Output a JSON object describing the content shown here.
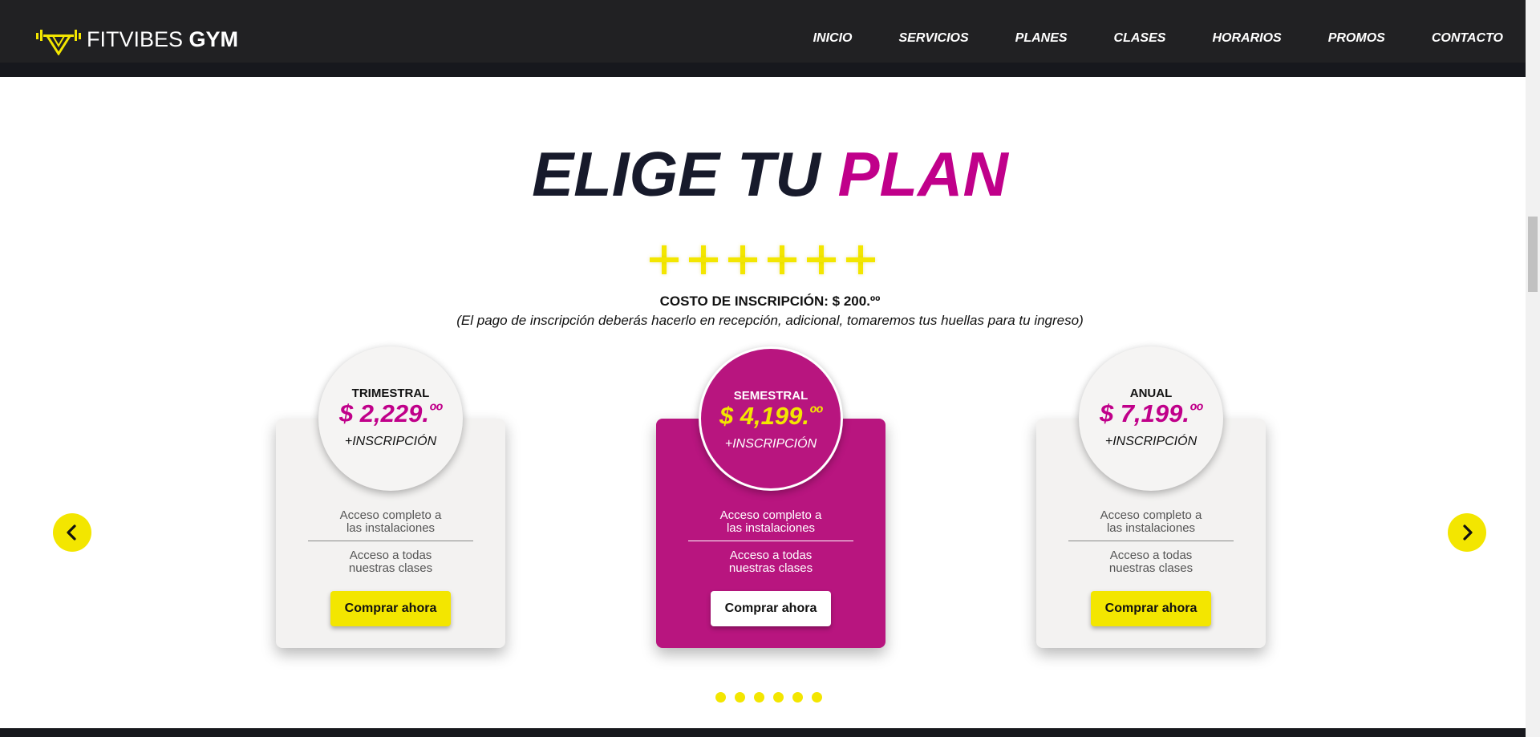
{
  "brand": {
    "name_light": "FITVIBES",
    "name_bold": "GYM",
    "logo_icon": "dumbbell-v-icon"
  },
  "nav": {
    "items": [
      "INICIO",
      "SERVICIOS",
      "PLANES",
      "CLASES",
      "HORARIOS",
      "PROMOS",
      "CONTACTO"
    ]
  },
  "section": {
    "title_part1": "ELIGE TU",
    "title_part2": "PLAN",
    "decor_plus_count": 6,
    "cost_line": "COSTO DE INSCRIPCIÓN: $ 200.ºº",
    "cost_note": "(El pago de inscripción deberás hacerlo en recepción, adicional, tomaremos tus huellas para tu ingreso)"
  },
  "plans": [
    {
      "name": "TRIMESTRAL",
      "price": "$ 2,229.",
      "price_sup": "ºº",
      "insc": "+INSCRIPCIÓN",
      "feature1_line1": "Acceso completo a",
      "feature1_line2": "las instalaciones",
      "feature2_line1": "Acceso a todas",
      "feature2_line2": "nuestras clases",
      "button": "Comprar ahora",
      "featured": false
    },
    {
      "name": "SEMESTRAL",
      "price": "$ 4,199.",
      "price_sup": "ºº",
      "insc": "+INSCRIPCIÓN",
      "feature1_line1": "Acceso completo a",
      "feature1_line2": "las instalaciones",
      "feature2_line1": "Acceso a todas",
      "feature2_line2": "nuestras clases",
      "button": "Comprar ahora",
      "featured": true
    },
    {
      "name": "ANUAL",
      "price": "$ 7,199.",
      "price_sup": "ºº",
      "insc": "+INSCRIPCIÓN",
      "feature1_line1": "Acceso completo a",
      "feature1_line2": "las instalaciones",
      "feature2_line1": "Acceso a todas",
      "feature2_line2": "nuestras clases",
      "button": "Comprar ahora",
      "featured": false
    }
  ],
  "carousel": {
    "prev_icon": "chevron-left-icon",
    "next_icon": "chevron-right-icon",
    "dot_count": 6
  },
  "colors": {
    "accent_magenta": "#c0008a",
    "accent_yellow": "#f3e600",
    "header_bg": "#212123",
    "title_dark": "#171a2b"
  }
}
